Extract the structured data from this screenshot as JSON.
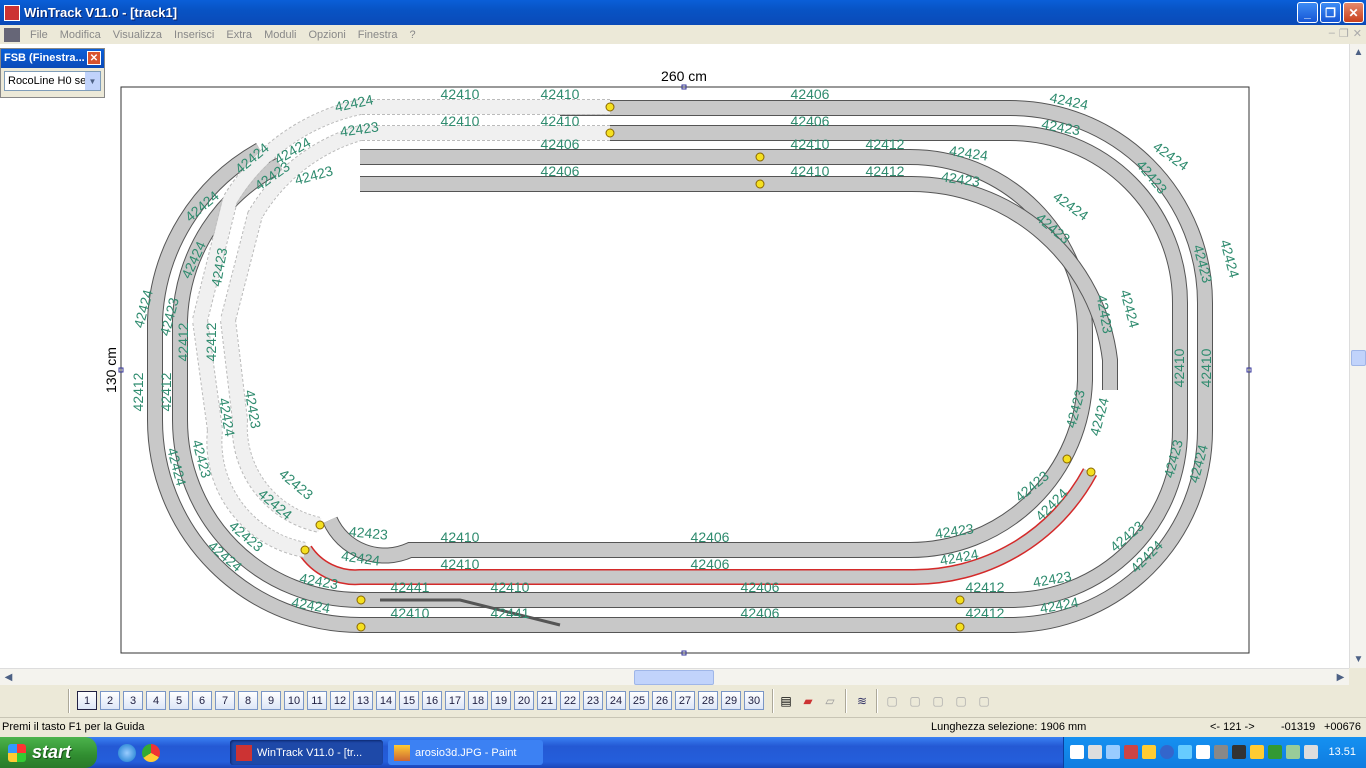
{
  "window": {
    "title": "WinTrack  V11.0 - [track1]"
  },
  "menu": [
    "File",
    "Modifica",
    "Visualizza",
    "Inserisci",
    "Extra",
    "Moduli",
    "Opzioni",
    "Finestra",
    "?"
  ],
  "fsb": {
    "title": "FSB (Finestra...",
    "select_value": "RocoLine H0 se"
  },
  "dims": {
    "width": "260 cm",
    "height": "130 cm"
  },
  "labels": {
    "a": "42424",
    "b": "42423",
    "c": "42410",
    "d": "42406",
    "e": "42412",
    "f": "42441"
  },
  "toolbar": {
    "pages": [
      "1",
      "2",
      "3",
      "4",
      "5",
      "6",
      "7",
      "8",
      "9",
      "10",
      "11",
      "12",
      "13",
      "14",
      "15",
      "16",
      "17",
      "18",
      "19",
      "20",
      "21",
      "22",
      "23",
      "24",
      "25",
      "26",
      "27",
      "28",
      "29",
      "30"
    ]
  },
  "status": {
    "help": "Premi il tasto F1 per la Guida",
    "selection": "Lunghezza selezione:  1906 mm",
    "nav": "<- 121 ->",
    "x": "-01319",
    "y": "+00676"
  },
  "taskbar": {
    "start": "start",
    "tasks": [
      "WinTrack  V11.0 - [tr...",
      "arosio3d.JPG - Paint"
    ],
    "clock": "13.51"
  },
  "colors": {
    "label": "#2e8b6e",
    "selected": "#d42a2a",
    "track": "#c8c8c8"
  }
}
